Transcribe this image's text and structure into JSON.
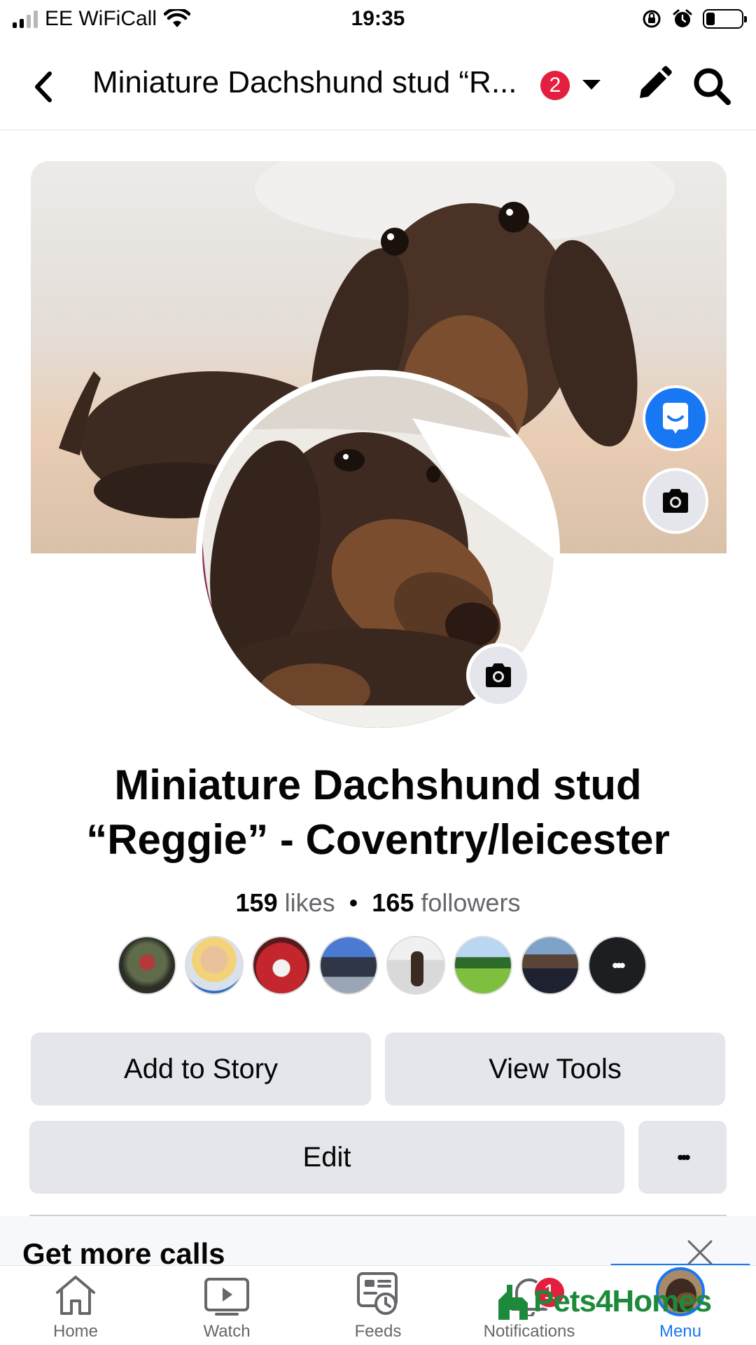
{
  "status_bar": {
    "carrier": "EE WiFiCall",
    "time": "19:35"
  },
  "header": {
    "title": "Miniature Dachshund stud “R...",
    "badge_count": "2"
  },
  "page": {
    "name": "Miniature Dachshund stud “Reggie” - Coventry/leicester",
    "likes_count": "159",
    "likes_label": "likes",
    "separator": "•",
    "followers_count": "165",
    "followers_label": "followers"
  },
  "follower_avatars_more": "•••",
  "buttons": {
    "add_to_story": "Add to Story",
    "view_tools": "View Tools",
    "edit": "Edit",
    "more": "•••"
  },
  "promo": {
    "title": "Get more calls"
  },
  "tabs": [
    {
      "label": "Home",
      "icon": "home-icon"
    },
    {
      "label": "Watch",
      "icon": "watch-icon"
    },
    {
      "label": "Feeds",
      "icon": "feeds-icon"
    },
    {
      "label": "Notifications",
      "icon": "bell-icon",
      "badge": "1"
    },
    {
      "label": "Menu",
      "icon": "avatar"
    }
  ],
  "watermark": "Pets4Homes",
  "colors": {
    "accent": "#1877f2",
    "badge": "#e41e3f",
    "button_bg": "#e4e6eb",
    "watermark": "#1d8a3b"
  }
}
